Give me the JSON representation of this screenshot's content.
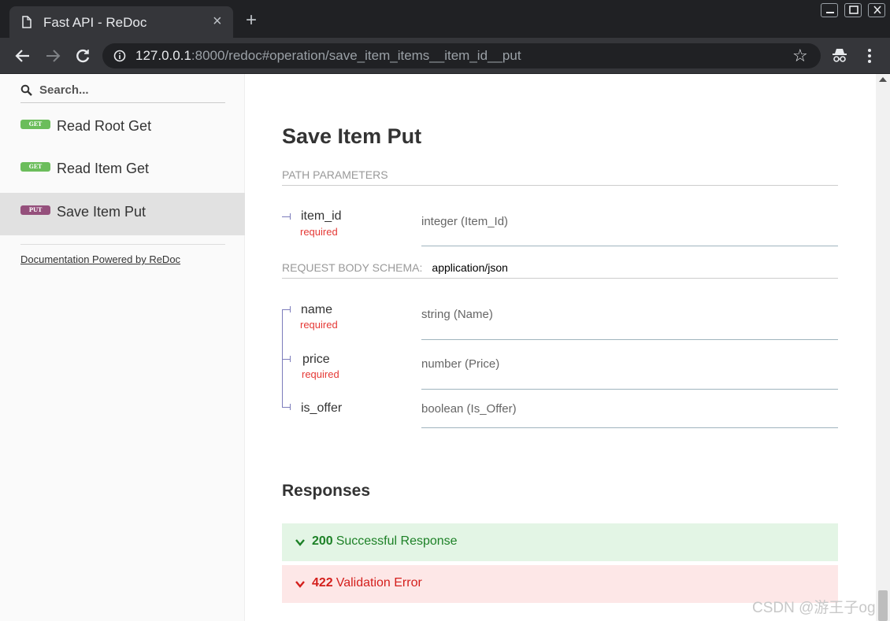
{
  "browser": {
    "tab_title": "Fast API - ReDoc",
    "close_glyph": "×",
    "newtab_glyph": "+",
    "url_host": "127.0.0.1",
    "url_rest": ":8000/redoc#operation/save_item_items__item_id__put",
    "star_glyph": "☆",
    "icons": [
      "document-icon",
      "back-arrow-icon",
      "forward-arrow-icon",
      "reload-icon",
      "info-icon",
      "star-icon",
      "incognito-icon",
      "kebab-menu-icon",
      "minimize-icon",
      "maximize-icon",
      "close-window-icon"
    ]
  },
  "sidebar": {
    "search_placeholder": "Search...",
    "items": [
      {
        "method": "GET",
        "label": "Read Root Get",
        "active": false
      },
      {
        "method": "GET",
        "label": "Read Item Get",
        "active": false
      },
      {
        "method": "PUT",
        "label": "Save Item Put",
        "active": true
      }
    ],
    "powered_by": "Documentation Powered by ReDoc"
  },
  "operation": {
    "title": "Save Item Put",
    "path_params_header": "PATH PARAMETERS",
    "path_params": [
      {
        "name": "item_id",
        "required": "required",
        "type": "integer (Item_Id)"
      }
    ],
    "body_header": "REQUEST BODY SCHEMA:",
    "body_content_type": "application/json",
    "body_params": [
      {
        "name": "name",
        "required": "required",
        "type": "string (Name)"
      },
      {
        "name": "price",
        "required": "required",
        "type": "number (Price)"
      },
      {
        "name": "is_offer",
        "required": "",
        "type": "boolean (Is_Offer)"
      }
    ]
  },
  "responses": {
    "title": "Responses",
    "items": [
      {
        "code": "200",
        "text": "Successful Response",
        "color": "#1d8127",
        "bg": "#e3f5e5"
      },
      {
        "code": "422",
        "text": "Validation Error",
        "color": "#d41f1c",
        "bg": "#fde7e7"
      }
    ]
  },
  "colors": {
    "get_badge": "#6bbd5b",
    "put_badge": "#95507c",
    "required": "#e53935"
  },
  "watermark": "CSDN @游王子og"
}
